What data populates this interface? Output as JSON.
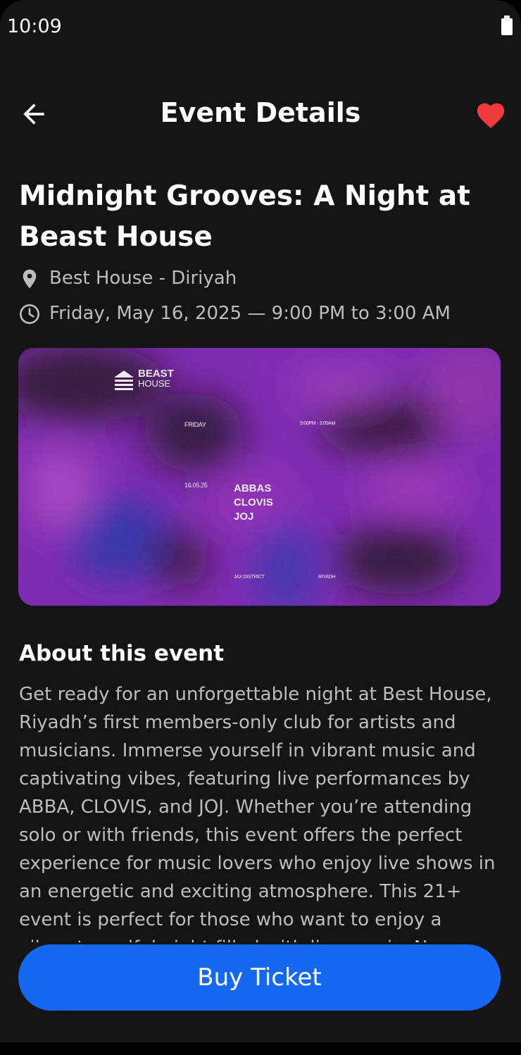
{
  "status_bar": {
    "time": "10:09",
    "icons": [
      "battery-icon"
    ]
  },
  "app_bar": {
    "title": "Event Details",
    "back_icon": "arrow-left-icon",
    "favorite_icon": "heart-icon",
    "favorite_color": "#ef3b3b",
    "favorited": true
  },
  "event": {
    "title": "Midnight Grooves: A Night at Beast House",
    "location_icon": "map-pin-icon",
    "location": "Best House - Diriyah",
    "time_icon": "clock-icon",
    "datetime": "Friday, May 16, 2025 — 9:00 PM to 3:00 AM"
  },
  "poster": {
    "logo_line1": "BEAST",
    "logo_line2": "HOUSE",
    "day": "FRIDAY",
    "hours": "9:00PM - 3:00AM",
    "date": "16.05.25",
    "artists": [
      "ABBAS",
      "CLOVIS",
      "JOJ"
    ],
    "district": "JAX DISTRICT",
    "city": "RIYADH"
  },
  "about": {
    "heading": "About this event",
    "body": "Get ready for an unforgettable night at Best House, Riyadh’s first members-only club for artists and musicians. Immerse yourself in vibrant music and captivating vibes, featuring live performances by ABBA, CLOVIS, and JOJ. Whether you’re attending solo or with friends, this event offers the perfect experience for music lovers who enjoy live shows in an energetic and exciting atmosphere. This 21+ event is perfect for those who want to enjoy a vibrant, soulful night filled with live music. N"
  },
  "cta": {
    "label": "Buy Ticket",
    "color": "#1668f2"
  }
}
